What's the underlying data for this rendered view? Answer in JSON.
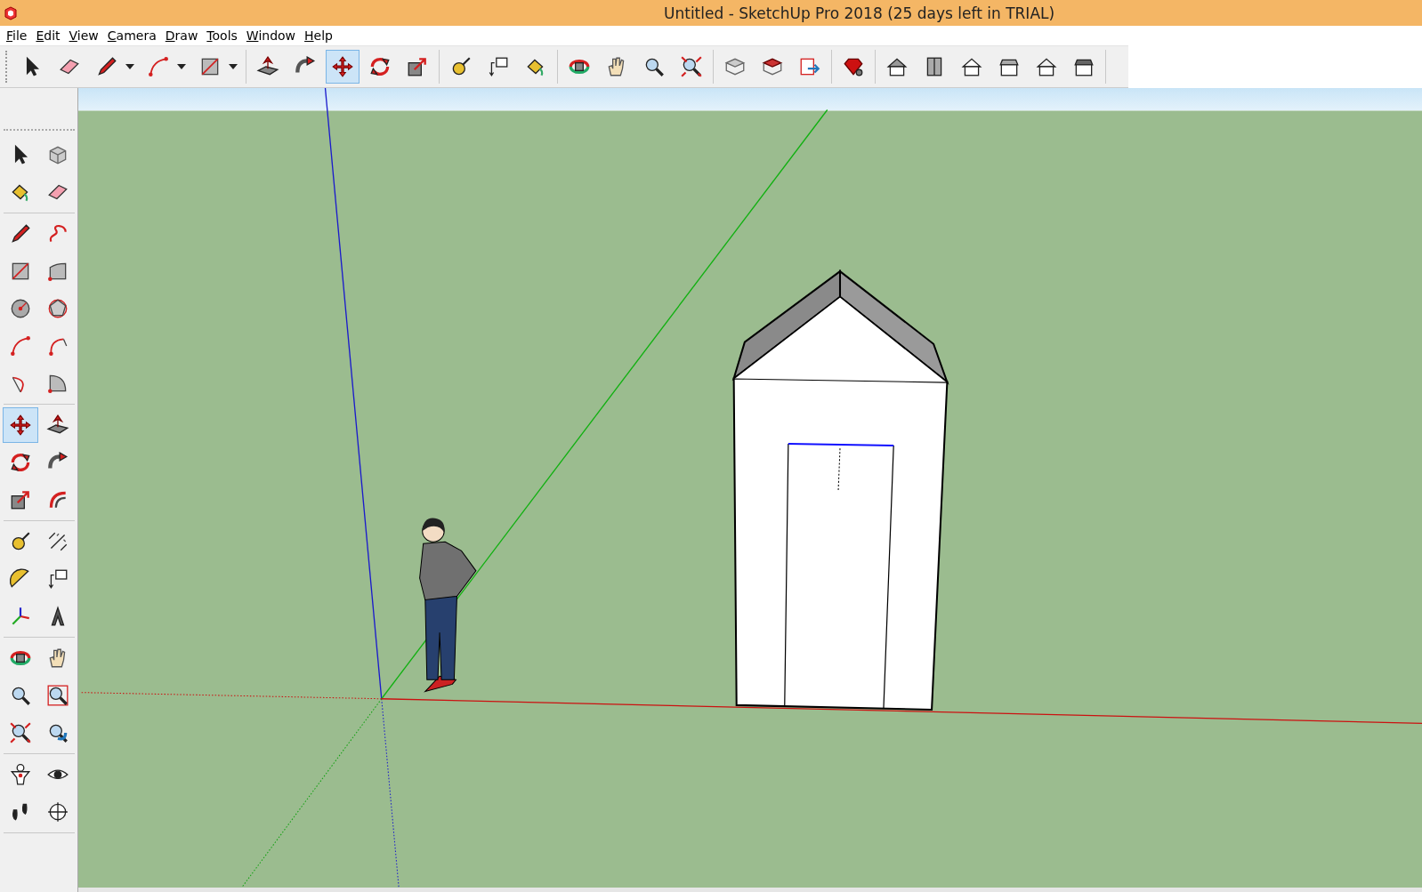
{
  "window": {
    "title": "Untitled - SketchUp Pro 2018 (25 days left in TRIAL)"
  },
  "menu": [
    "File",
    "Edit",
    "View",
    "Camera",
    "Draw",
    "Tools",
    "Window",
    "Help"
  ],
  "toolbar": {
    "groups": [
      [
        {
          "kind": "select",
          "selected": false
        },
        {
          "kind": "eraser",
          "selected": false
        },
        {
          "kind": "pencil",
          "selected": false,
          "dropdown": true
        },
        {
          "kind": "arc",
          "selected": false,
          "dropdown": true
        },
        {
          "kind": "rect",
          "selected": false,
          "dropdown": true
        }
      ],
      [
        {
          "kind": "pushpull",
          "selected": false
        },
        {
          "kind": "followme",
          "selected": false
        },
        {
          "kind": "move",
          "selected": true
        },
        {
          "kind": "rotate",
          "selected": false
        },
        {
          "kind": "scale",
          "selected": false
        }
      ],
      [
        {
          "kind": "tape",
          "selected": false
        },
        {
          "kind": "text",
          "selected": false
        },
        {
          "kind": "paint",
          "selected": false
        }
      ],
      [
        {
          "kind": "orbit",
          "selected": false
        },
        {
          "kind": "pan",
          "selected": false
        },
        {
          "kind": "zoom",
          "selected": false
        },
        {
          "kind": "zoomext",
          "selected": false
        }
      ],
      [
        {
          "kind": "warehouse",
          "selected": false
        },
        {
          "kind": "extension",
          "selected": false
        },
        {
          "kind": "layout",
          "selected": false
        }
      ],
      [
        {
          "kind": "ruby",
          "selected": false
        }
      ],
      [
        {
          "kind": "iso",
          "selected": false
        },
        {
          "kind": "top",
          "selected": false
        },
        {
          "kind": "front",
          "selected": false
        },
        {
          "kind": "right",
          "selected": false
        },
        {
          "kind": "back",
          "selected": false
        },
        {
          "kind": "left",
          "selected": false
        }
      ]
    ]
  },
  "side_toolbar": {
    "groups": [
      [
        {
          "kind": "select",
          "selected": false
        },
        {
          "kind": "component",
          "selected": false
        },
        {
          "kind": "paint",
          "selected": false
        },
        {
          "kind": "eraser",
          "selected": false
        }
      ],
      [
        {
          "kind": "pencil",
          "selected": false
        },
        {
          "kind": "freehand",
          "selected": false
        },
        {
          "kind": "rect",
          "selected": false
        },
        {
          "kind": "rotrect",
          "selected": false
        },
        {
          "kind": "circle",
          "selected": false
        },
        {
          "kind": "polygon",
          "selected": false
        },
        {
          "kind": "arc",
          "selected": false
        },
        {
          "kind": "arc2",
          "selected": false
        },
        {
          "kind": "arc3",
          "selected": false
        },
        {
          "kind": "pie",
          "selected": false
        }
      ],
      [
        {
          "kind": "move",
          "selected": true
        },
        {
          "kind": "pushpull",
          "selected": false
        },
        {
          "kind": "rotate",
          "selected": false
        },
        {
          "kind": "followme",
          "selected": false
        },
        {
          "kind": "scale",
          "selected": false
        },
        {
          "kind": "offset",
          "selected": false
        }
      ],
      [
        {
          "kind": "tape",
          "selected": false
        },
        {
          "kind": "dimension",
          "selected": false
        },
        {
          "kind": "protractor",
          "selected": false
        },
        {
          "kind": "text",
          "selected": false
        },
        {
          "kind": "axes",
          "selected": false
        },
        {
          "kind": "text3d",
          "selected": false
        }
      ],
      [
        {
          "kind": "orbit",
          "selected": false
        },
        {
          "kind": "pan",
          "selected": false
        },
        {
          "kind": "zoom",
          "selected": false
        },
        {
          "kind": "zoomwin",
          "selected": false
        },
        {
          "kind": "zoomext",
          "selected": false
        },
        {
          "kind": "previous",
          "selected": false
        }
      ],
      [
        {
          "kind": "camera",
          "selected": false
        },
        {
          "kind": "lookaround",
          "selected": false
        },
        {
          "kind": "walk",
          "selected": false
        },
        {
          "kind": "section",
          "selected": false
        }
      ]
    ]
  }
}
